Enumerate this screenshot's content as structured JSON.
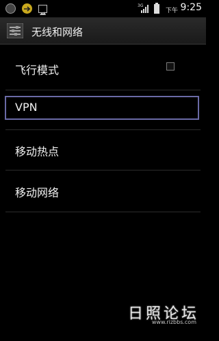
{
  "status_bar": {
    "ampm": "下午",
    "time": "9:25",
    "icons": [
      "round-notification-icon",
      "usb-icon",
      "image-icon",
      "3g-signal-icon",
      "battery-icon"
    ]
  },
  "header": {
    "title": "无线和网络",
    "icon": "settings-sliders-icon"
  },
  "settings": {
    "items": [
      {
        "label": "飞行模式",
        "checked": false
      },
      {
        "label": "VPN",
        "focused": true
      },
      {
        "label": "移动热点"
      },
      {
        "label": "移动网络"
      }
    ]
  },
  "watermark": {
    "title": "日照论坛",
    "url": "www.rizbbs.com"
  }
}
